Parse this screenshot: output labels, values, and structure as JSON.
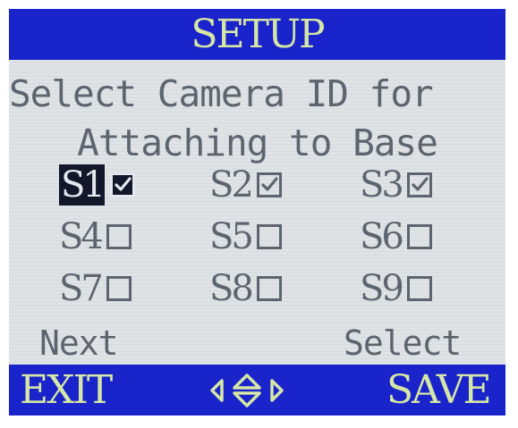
{
  "header": {
    "title": "SETUP"
  },
  "prompt": {
    "line1": "Select Camera ID for",
    "line2": "Attaching to Base"
  },
  "cameras": [
    {
      "label": "S1",
      "checked": true,
      "selected": true
    },
    {
      "label": "S2",
      "checked": true,
      "selected": false
    },
    {
      "label": "S3",
      "checked": true,
      "selected": false
    },
    {
      "label": "S4",
      "checked": false,
      "selected": false
    },
    {
      "label": "S5",
      "checked": false,
      "selected": false
    },
    {
      "label": "S6",
      "checked": false,
      "selected": false
    },
    {
      "label": "S7",
      "checked": false,
      "selected": false
    },
    {
      "label": "S8",
      "checked": false,
      "selected": false
    },
    {
      "label": "S9",
      "checked": false,
      "selected": false
    }
  ],
  "hints": {
    "next_label": "Next",
    "select_label": "Select"
  },
  "footer": {
    "exit_label": "EXIT",
    "save_label": "SAVE"
  },
  "icons": {
    "next": "left-right-arrows-icon",
    "select": "up-down-arrows-icon",
    "nav": "four-way-arrows-icon"
  },
  "colors": {
    "bar_background": "#1a24cc",
    "bar_text": "#d8e8a8",
    "screen_background": "#dfe3e6",
    "text": "#5d6670",
    "selection_background": "#12182a"
  }
}
